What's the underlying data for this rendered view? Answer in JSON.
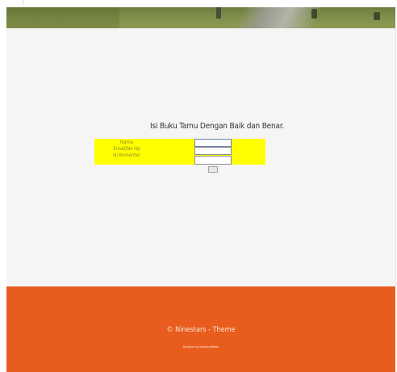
{
  "form": {
    "title": "Isi Buku Tamu Dengan Baik dan Benar.",
    "fields": [
      {
        "label": "Nama",
        "value": ""
      },
      {
        "label": "Email/No Hp",
        "value": ""
      },
      {
        "label": "Isi Komentar",
        "value": ""
      }
    ],
    "submit_label": "",
    "highlight_color": "#ffff00"
  },
  "footer": {
    "copyright": "© Ninestars - Theme",
    "credit": "Designed by BootstrapMade",
    "background_color": "#e85d1e"
  }
}
